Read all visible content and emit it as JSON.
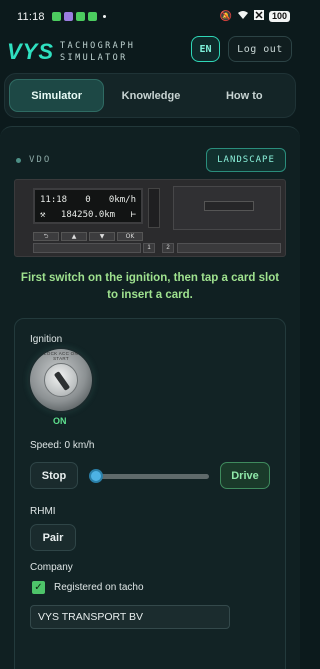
{
  "status_bar": {
    "time": "11:18",
    "battery": "100",
    "app_colors": [
      "#4ccc5f",
      "#9b7de0",
      "#4ccc5f",
      "#4ccc5f"
    ]
  },
  "header": {
    "logo_mark": "VYS",
    "logo_line1": "TACHOGRAPH",
    "logo_line2": "SIMULATOR",
    "lang": "EN",
    "logout": "Log out"
  },
  "tabs": [
    {
      "label": "Simulator",
      "active": true
    },
    {
      "label": "Knowledge",
      "active": false
    },
    {
      "label": "How to",
      "active": false
    }
  ],
  "device": {
    "label": "VDO",
    "orientation_button": "LANDSCAPE"
  },
  "tachograph": {
    "display_line1_left": "11:18",
    "display_line1_mid": "0",
    "display_line1_right": "0km/h",
    "display_line2_left": "",
    "display_line2_mid": "184250.0km",
    "display_line2_right": "",
    "buttons": [
      "⮌",
      "▲",
      "▼",
      "OK"
    ],
    "card_slot_icons": [
      "1",
      "2"
    ]
  },
  "instruction": "First switch on the ignition, then tap a card slot to insert a card.",
  "controls": {
    "ignition_label": "Ignition",
    "ignition_state": "ON",
    "ignition_ring_text": "LOCK ACC ON START",
    "speed_label": "Speed: 0 km/h",
    "speed_fraction": 0.0,
    "stop_label": "Stop",
    "drive_label": "Drive",
    "rhmi_label": "RHMI",
    "pair_label": "Pair",
    "company_label": "Company",
    "registered_label": "Registered on tacho",
    "registered_checked": true,
    "company_value": "VYS TRANSPORT BV"
  }
}
